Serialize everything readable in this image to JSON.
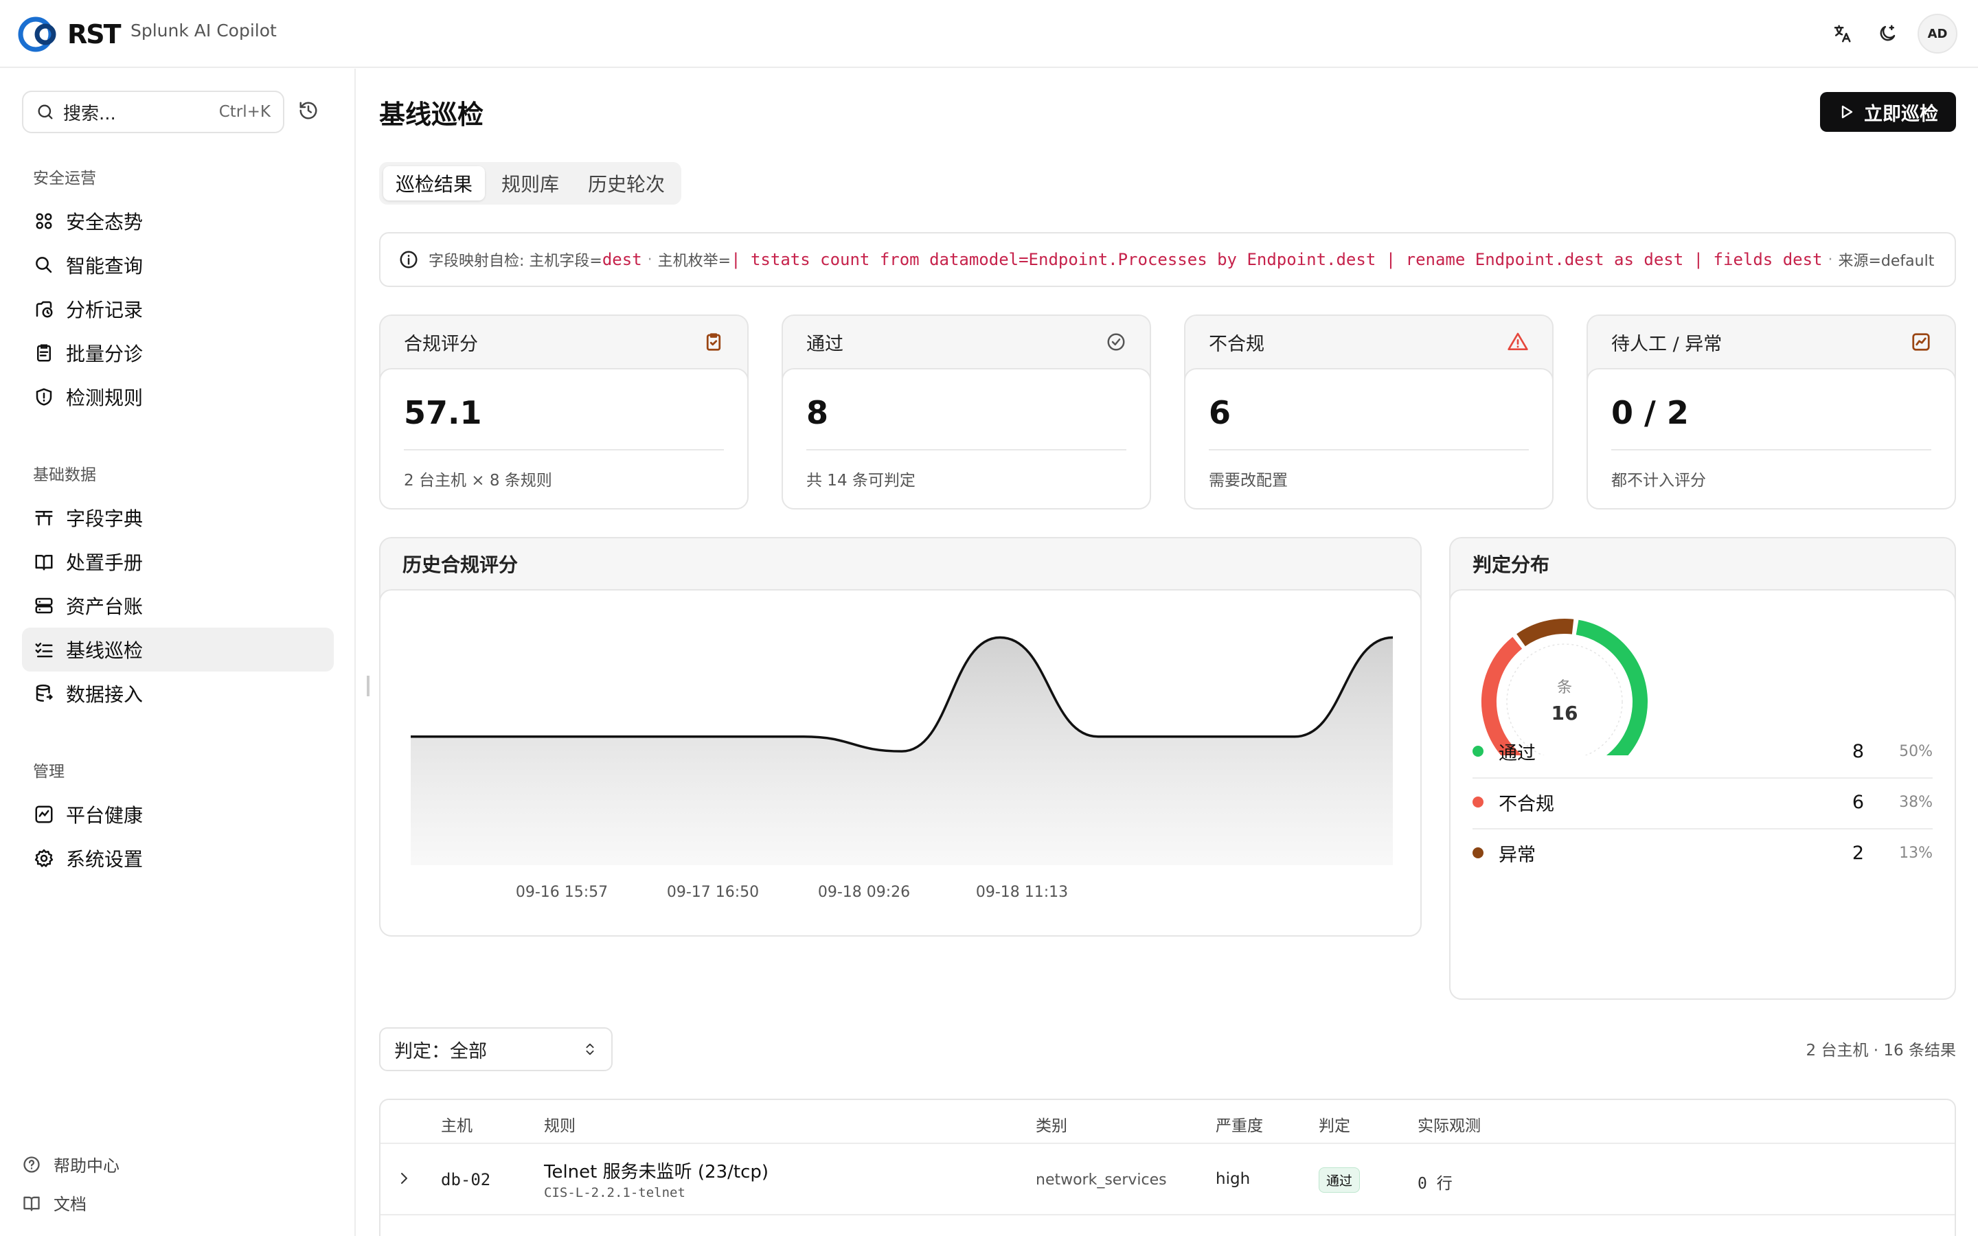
{
  "header": {
    "logo_text": "RST",
    "app_name": "Splunk AI Copilot",
    "avatar_initials": "AD",
    "icons": [
      "translate-icon",
      "theme-toggle-icon"
    ]
  },
  "sidebar": {
    "search": {
      "placeholder": "搜索...",
      "shortcut": "Ctrl+K"
    },
    "sections": [
      {
        "title": "安全运营",
        "items": [
          {
            "label": "安全态势",
            "icon": "grid-icon"
          },
          {
            "label": "智能查询",
            "icon": "search-icon"
          },
          {
            "label": "分析记录",
            "icon": "history-icon"
          },
          {
            "label": "批量分诊",
            "icon": "clipboard-icon"
          },
          {
            "label": "检测规则",
            "icon": "shield-icon"
          }
        ]
      },
      {
        "title": "基础数据",
        "items": [
          {
            "label": "字段字典",
            "icon": "table-icon"
          },
          {
            "label": "处置手册",
            "icon": "book-icon"
          },
          {
            "label": "资产台账",
            "icon": "server-icon"
          },
          {
            "label": "基线巡检",
            "icon": "checklist-icon"
          },
          {
            "label": "数据接入",
            "icon": "database-icon"
          }
        ]
      },
      {
        "title": "管理",
        "items": [
          {
            "label": "平台健康",
            "icon": "activity-icon"
          },
          {
            "label": "系统设置",
            "icon": "gear-icon"
          }
        ]
      }
    ],
    "footer": [
      {
        "label": "帮助中心",
        "icon": "help-icon"
      },
      {
        "label": "文档",
        "icon": "book-icon"
      }
    ]
  },
  "page": {
    "title": "基线巡检",
    "run_button": "立即巡检",
    "tabs": [
      "巡检结果",
      "规则库",
      "历史轮次"
    ],
    "active_tab": "巡检结果"
  },
  "info": {
    "prefix": "字段映射自检: 主机字段=",
    "host_field": "dest",
    "enum_label": "主机枚举=",
    "enum_query": "| tstats count from datamodel=Endpoint.Processes by Endpoint.dest | rename Endpoint.dest as dest | fields dest",
    "source_text": "来源=default"
  },
  "kpis": [
    {
      "title": "合规评分",
      "value": "57.1",
      "sub": "2 台主机 × 8 条规则",
      "icon": "clipboard-check-icon",
      "color": "#9a4512"
    },
    {
      "title": "通过",
      "value": "8",
      "sub": "共 14 条可判定",
      "icon": "check-circle-icon",
      "color": "#555555"
    },
    {
      "title": "不合规",
      "value": "6",
      "sub": "需要改配置",
      "icon": "warning-icon",
      "color": "#e5483d"
    },
    {
      "title": "待人工 / 异常",
      "value": "0 / 2",
      "sub": "都不计入评分",
      "icon": "trend-icon",
      "color": "#9a4512"
    }
  ],
  "history_panel": {
    "title": "历史合规评分"
  },
  "chart_data": {
    "type": "area",
    "title": "历史合规评分",
    "x_tick_labels": [
      "09-16 15:57",
      "09-17 16:50",
      "09-18 09:26",
      "09-18 11:13"
    ],
    "values": [
      57.1,
      57.1,
      57.1,
      57.1,
      57.1,
      54,
      78,
      57.1,
      57.1,
      57.1,
      78
    ],
    "ylim": [
      30,
      85
    ],
    "grid": false,
    "color": "#111111"
  },
  "distribution": {
    "title": "判定分布",
    "center_label": "条",
    "total": "16",
    "items": [
      {
        "name": "通过",
        "count": 8,
        "count_text": "8",
        "pct": "50%",
        "color": "#22c55e"
      },
      {
        "name": "不合规",
        "count": 6,
        "count_text": "6",
        "pct": "38%",
        "color": "#f05a4a"
      },
      {
        "name": "异常",
        "count": 2,
        "count_text": "2",
        "pct": "13%",
        "color": "#8b4513"
      }
    ]
  },
  "filter": {
    "label": "判定：全部"
  },
  "results_summary": "2 台主机 · 16 条结果",
  "table": {
    "headers": [
      "主机",
      "规则",
      "类别",
      "严重度",
      "判定",
      "实际观测"
    ],
    "rows": [
      {
        "host": "db-02",
        "rule": "Telnet 服务未监听 (23/tcp)",
        "rule_id": "CIS-L-2.2.1-telnet",
        "category": "network_services",
        "severity": "high",
        "verdict": "通过",
        "observed": "0 行"
      }
    ]
  }
}
